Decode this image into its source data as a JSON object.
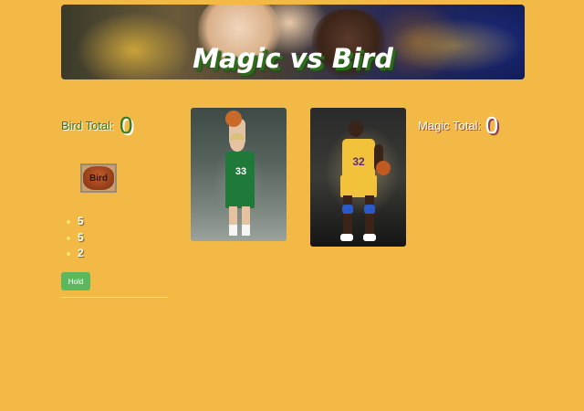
{
  "banner": {
    "title": "Magic vs Bird"
  },
  "bird": {
    "total_label": "Bird Total:",
    "total_value": "0",
    "button_label": "Bird",
    "jersey_number": "33",
    "rolls": [
      "5",
      "5",
      "2"
    ]
  },
  "magic": {
    "total_label": "Magic Total:",
    "total_value": "0",
    "jersey_number": "32"
  },
  "controls": {
    "hold_label": "Hold"
  },
  "colors": {
    "background": "#f2b947",
    "bird_green": "#2f7a24",
    "hold_button": "#5cb85c"
  }
}
